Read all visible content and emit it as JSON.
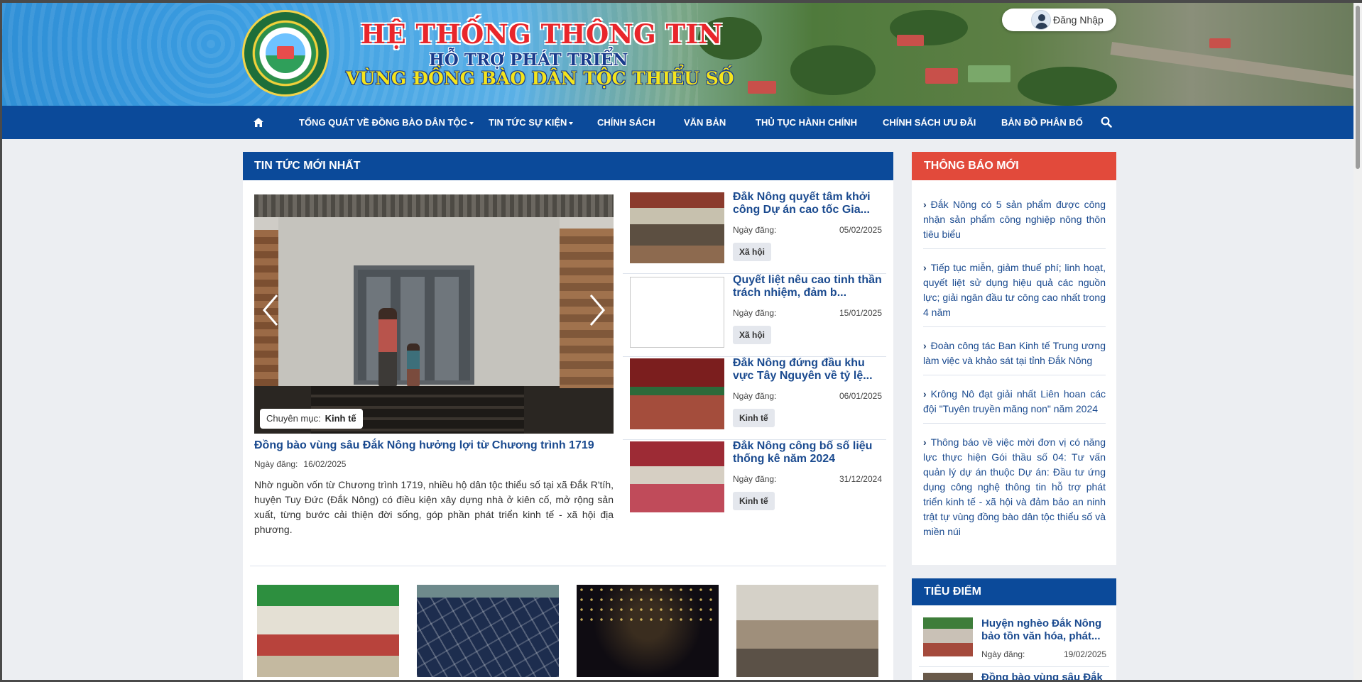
{
  "header": {
    "title_line1": "HỆ THỐNG THÔNG TIN",
    "title_line2": "HỖ TRỢ PHÁT TRIỂN",
    "title_line3": "VÙNG ĐỒNG BÀO DÂN TỘC THIỂU SỐ",
    "login_label": "Đăng Nhập"
  },
  "nav": {
    "items": [
      {
        "label": "TỔNG QUÁT VỀ ĐỒNG BÀO DÂN TỘC",
        "dropdown": true
      },
      {
        "label": "TIN TỨC SỰ KIỆN",
        "dropdown": true
      },
      {
        "label": "CHÍNH SÁCH"
      },
      {
        "label": "VĂN BẢN"
      },
      {
        "label": "THỦ TỤC HÀNH CHÍNH"
      },
      {
        "label": "CHÍNH SÁCH ƯU ĐÃI"
      },
      {
        "label": "BẢN ĐỒ PHÂN BỐ"
      }
    ],
    "icons": [
      "home-icon",
      "search-icon"
    ]
  },
  "latest": {
    "heading": "TIN TỨC MỚI NHẤT",
    "featured": {
      "category_label": "Chuyên mục:",
      "category": "Kinh tế",
      "title": "Đồng bào vùng sâu Đắk Nông hưởng lợi từ Chương trình 1719",
      "date_label": "Ngày đăng:",
      "date": "16/02/2025",
      "description": "Nhờ nguồn vốn từ Chương trình 1719, nhiều hộ dân tộc thiểu số tại xã Đắk R'tíh, huyện Tuy Đức (Đắk Nông) có điều kiện xây dựng nhà ở kiên cố, mở rộng sản xuất, từng bước cải thiện đời sống, góp phần phát triển kinh tế - xã hội địa phương."
    },
    "list": [
      {
        "title": "Đắk Nông quyết tâm khởi công Dự án cao tốc Gia...",
        "date_label": "Ngày đăng:",
        "date": "05/02/2025",
        "tag": "Xã hội"
      },
      {
        "title": "Quyết liệt nêu cao tinh thần trách nhiệm, đảm b...",
        "date_label": "Ngày đăng:",
        "date": "15/01/2025",
        "tag": "Xã hội"
      },
      {
        "title": "Đắk Nông đứng đầu khu vực Tây Nguyên về tỷ lệ...",
        "date_label": "Ngày đăng:",
        "date": "06/01/2025",
        "tag": "Kinh tế"
      },
      {
        "title": "Đắk Nông công bố số liệu thống kê năm 2024",
        "date_label": "Ngày đăng:",
        "date": "31/12/2024",
        "tag": "Kinh tế"
      }
    ]
  },
  "notices": {
    "heading": "THÔNG BÁO MỚI",
    "items": [
      "Đắk Nông có 5 sản phẩm được công nhận sản phẩm công nghiệp nông thôn tiêu biểu",
      "Tiếp tục miễn, giảm thuế phí; linh hoạt, quyết liệt sử dụng hiệu quả các nguồn lực; giải ngân đầu tư công cao nhất trong 4 năm",
      "Đoàn công tác Ban Kinh tế Trung ương làm việc và khảo sát tại tỉnh Đắk Nông",
      "Krông Nô đạt giải nhất Liên hoan các đội \"Tuyên truyền măng non\" năm 2024",
      "Thông báo về việc mời đơn vị có năng lực thực hiện Gói thầu số 04: Tư vấn quản lý dự án thuộc Dự án: Đầu tư ứng dụng công nghệ thông tin hỗ trợ phát triển kinh tế - xã hội và đảm bảo an ninh trật tự vùng đồng bào dân tộc thiểu số và miền núi"
    ]
  },
  "focus": {
    "heading": "TIÊU ĐIỂM",
    "items": [
      {
        "title": "Huyện nghèo Đắk Nông bảo tồn văn hóa, phát...",
        "date_label": "Ngày đăng:",
        "date": "19/02/2025"
      },
      {
        "title": "Đồng bào vùng sâu Đắk"
      }
    ]
  }
}
